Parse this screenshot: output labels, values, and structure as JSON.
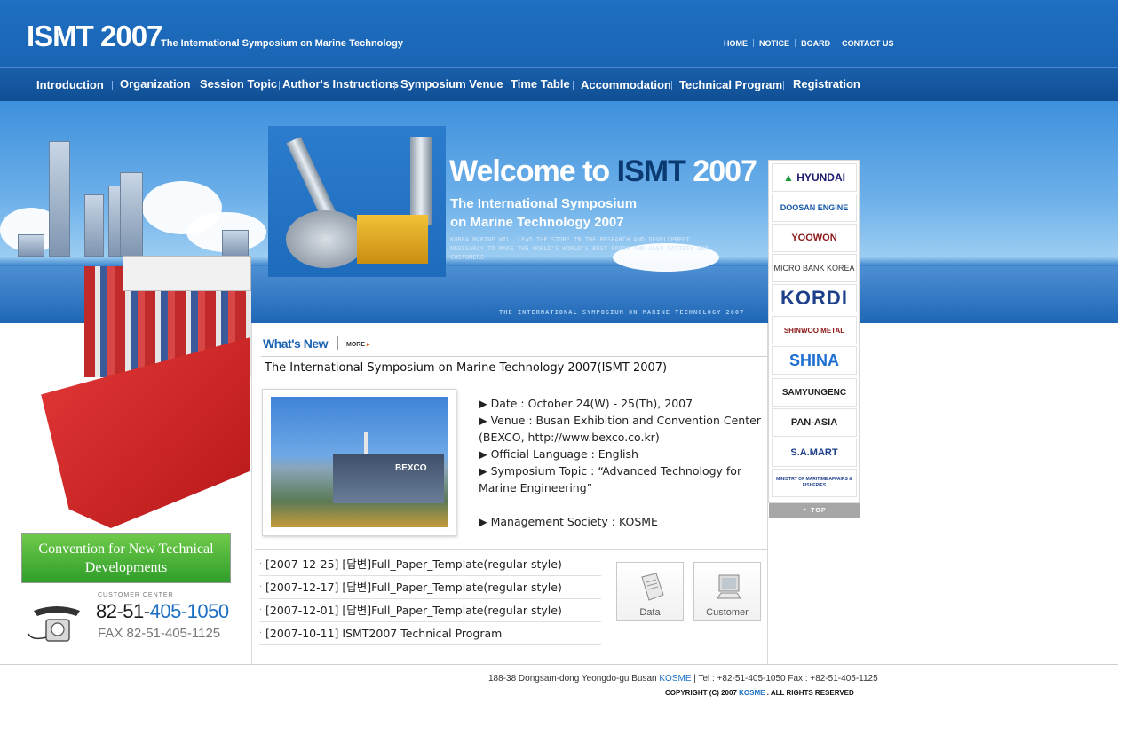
{
  "header": {
    "logo": "ISMT 2007",
    "subtitle": "The International Symposium on Marine Technology",
    "top_links": [
      "HOME",
      "NOTICE",
      "BOARD",
      "CONTACT US"
    ]
  },
  "nav": {
    "items": [
      "Introduction",
      "Organization",
      "Session Topic",
      "Author's Instructions",
      "Symposium Venue",
      "Time Table",
      "Accommodation",
      "Technical Program",
      "Registration"
    ]
  },
  "banner": {
    "welcome_prefix": "Welcome to ",
    "welcome_highlight": "ISMT",
    "welcome_suffix": " 2007",
    "line1": "The International Symposium",
    "line2": "on Marine Technology 2007",
    "tagline": "KOREA MARINE WILL LEAD THE STORE IN THE RESEARCH AND DEVELOPMENT NESSSARAY TO MAKE THE WORLD'S WORLD'S BEST FOODS AND ALSO SATISFY OUR CUSTOMERS",
    "caption": "THE INTERNATIONAL SYMPOSIUM ON MARINE TECHNOLOGY 2007"
  },
  "left": {
    "convention": "Convention for New Technical Developments",
    "customer_label": "CUSTOMER CENTER",
    "tel_prefix": "82-51-",
    "tel_suffix": "405-1050",
    "fax": "FAX 82-51-405-1125"
  },
  "whats_new": {
    "heading": "What's New",
    "more": "MORE",
    "title": "The International Symposium on Marine Technology 2007(ISMT 2007)",
    "photo_sign": "BEXCO",
    "details": [
      "▶ Date : October 24(W) - 25(Th), 2007",
      "▶ Venue : Busan Exhibition and Convention Center (BEXCO, http://www.bexco.co.kr)",
      "▶ Official Language : English",
      "▶ Symposium Topic : “Advanced Technology for Marine Engineering”"
    ],
    "management": "▶ Management Society : KOSME"
  },
  "board": {
    "items": [
      "[2007-12-25] [답변]Full_Paper_Template(regular style)",
      "[2007-12-17] [답변]Full_Paper_Template(regular style)",
      "[2007-12-01] [답변]Full_Paper_Template(regular style)",
      "[2007-10-11] ISMT2007 Technical Program"
    ]
  },
  "quick": {
    "data": "Data",
    "customer": "Customer"
  },
  "sponsors": {
    "items": [
      "HYUNDAI",
      "DOOSAN ENGINE",
      "YOOWON",
      "MICRO BANK KOREA",
      "KORDI",
      "SHINWOO METAL",
      "SHINA",
      "SAMYUNGENC",
      "PAN-ASIA",
      "S.A.MART",
      "MINISTRY OF MARITIME AFFAIRS & FISHERIES"
    ],
    "top": "TOP"
  },
  "footer": {
    "address_pre": "188-38 Dongsam-dong Yeongdo-gu Busan ",
    "address_org": "KOSME",
    "address_post": "  |  Tel : +82-51-405-1050  Fax : +82-51-405-1125",
    "copy_pre": "COPYRIGHT (C) 2007 ",
    "copy_org": "KOSME",
    "copy_post": " . ALL RIGHTS RESERVED"
  },
  "colors": {
    "brand_blue": "#1a64b3",
    "accent_blue": "#1d6fc3",
    "green": "#3aa52e"
  }
}
